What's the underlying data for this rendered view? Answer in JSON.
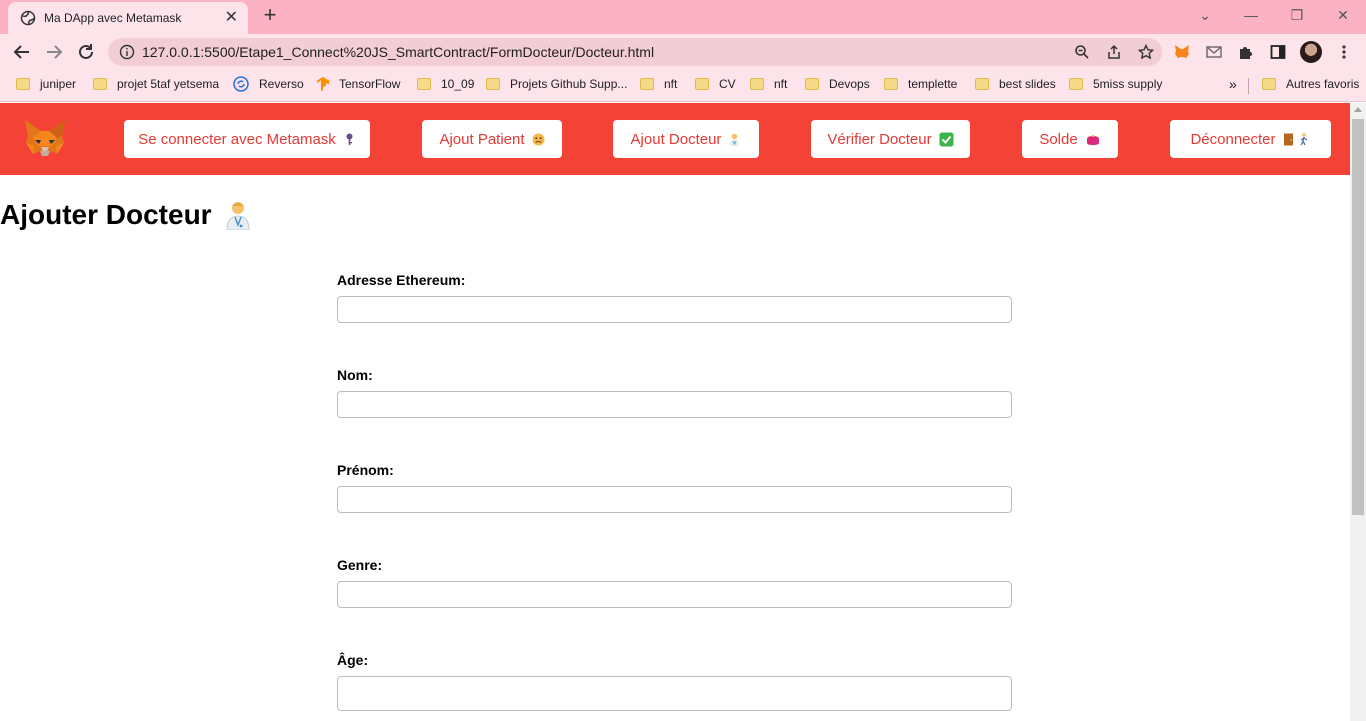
{
  "browser": {
    "tab_title": "Ma DApp avec Metamask",
    "url": "127.0.0.1:5500/Etape1_Connect%20JS_SmartContract/FormDocteur/Docteur.html",
    "bookmarks": [
      "juniper",
      "projet 5taf yetsema",
      "Reverso",
      "TensorFlow",
      "10_09",
      "Projets Github Supp...",
      "nft",
      "CV",
      "nft",
      "Devops",
      "templette",
      "best slides",
      "5miss supply"
    ],
    "more_bookmarks": "»",
    "other_favorites": "Autres favoris"
  },
  "navbar": {
    "buttons": [
      {
        "label": "Se connecter avec Metamask",
        "icon": "key-emoji"
      },
      {
        "label": "Ajout Patient",
        "icon": "sick-face-emoji"
      },
      {
        "label": "Ajout Docteur",
        "icon": "doctor-emoji"
      },
      {
        "label": "Vérifier Docteur",
        "icon": "check-mark-emoji"
      },
      {
        "label": "Solde",
        "icon": "purse-emoji"
      },
      {
        "label": "Déconnecter",
        "icon": "door-walking-emoji"
      }
    ]
  },
  "page": {
    "title": "Ajouter Docteur"
  },
  "form": {
    "fields": [
      {
        "label": "Adresse Ethereum:",
        "value": ""
      },
      {
        "label": "Nom:",
        "value": ""
      },
      {
        "label": "Prénom:",
        "value": ""
      },
      {
        "label": "Genre:",
        "value": ""
      },
      {
        "label": "Âge:",
        "value": ""
      }
    ]
  },
  "colors": {
    "navbar": "#f44336",
    "button_text": "#e53935",
    "tabstrip": "#fbb3c3",
    "toolbar": "#fde3ea"
  }
}
